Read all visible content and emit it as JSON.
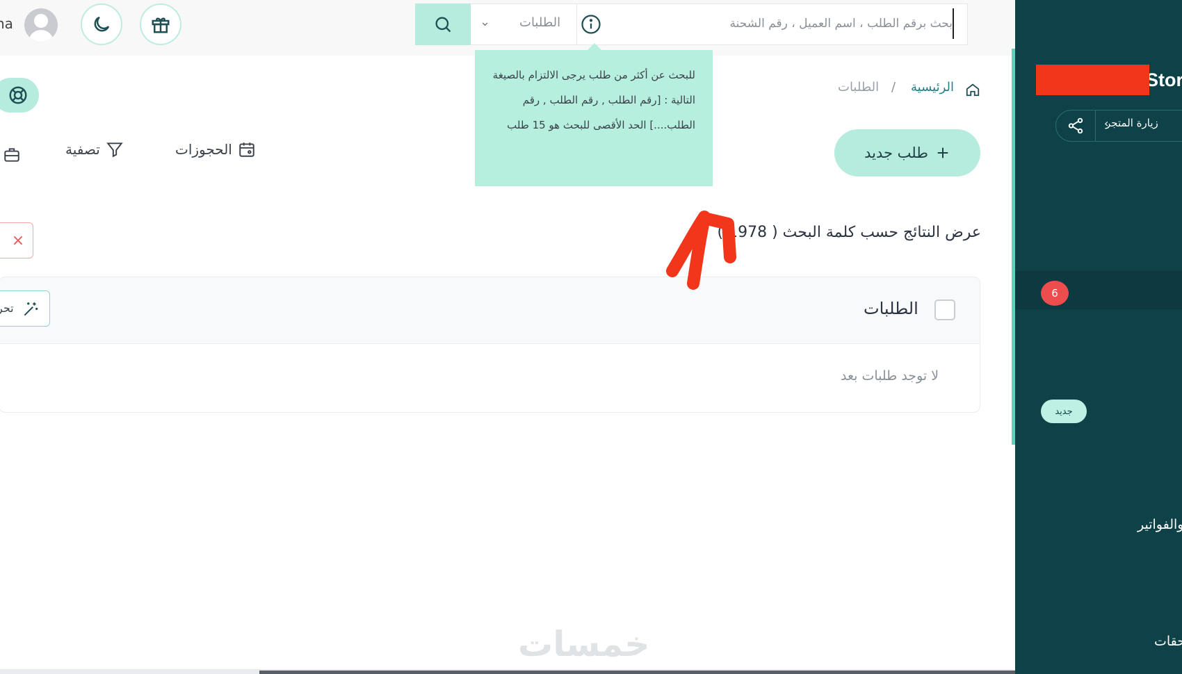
{
  "header": {
    "username": "na",
    "search": {
      "placeholder": "بحث برقم الطلب ، اسم العميل ، رقم الشحنة",
      "scope_label": "الطلبات"
    },
    "tooltip_text": "للبحث عن أكثر من طلب يرجى الالتزام بالصيغة التالية : [رقم الطلب , رقم الطلب , رقم الطلب....] الحد الأقصى للبحث هو 15 طلب"
  },
  "breadcrumb": {
    "home": "الرئيسية",
    "separator": "/",
    "current": "الطلبات"
  },
  "actions": {
    "new_order": "طلب جديد",
    "bookings": "الحجوزات",
    "filter": "تصفية"
  },
  "results": {
    "title": "عرض النتائج حسب كلمة البحث ( 1978 )",
    "clear_symbol": "×"
  },
  "orders_table": {
    "title": "الطلبات",
    "empty_message": "لا توجد طلبات بعد",
    "ai_button_label": "تحر"
  },
  "sidebar": {
    "store_name": "Stor",
    "visit_store": "زيارة المتجر",
    "notification_count": "6",
    "new_badge": "جديد",
    "invoices": "والفواتير",
    "apps": "لحقات"
  },
  "watermark": "خمسات",
  "colors": {
    "accent": "#b6ecdd",
    "sidebar_bg": "#0f4248",
    "badge_red": "#ee4d4d",
    "annotation_red": "#f2361c"
  },
  "icons": [
    "search-icon",
    "info-icon",
    "chevron-down-icon",
    "gift-icon",
    "moon-icon",
    "home-icon",
    "plus-icon",
    "calendar-icon",
    "filter-icon",
    "briefcase-icon",
    "lifebuoy-icon",
    "close-icon",
    "magic-wand-icon",
    "share-icon",
    "chevron-left-icon"
  ]
}
